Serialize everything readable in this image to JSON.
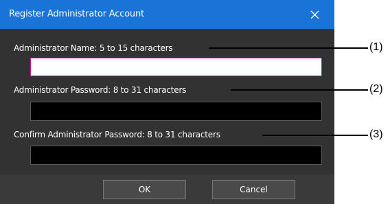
{
  "dialog": {
    "title": "Register Administrator Account",
    "close_icon": "close-icon",
    "fields": [
      {
        "label": "Administrator Name:  5 to 15 characters",
        "value": ""
      },
      {
        "label": "Administrator Password:  8 to 31 characters",
        "value": ""
      },
      {
        "label": "Confirm Administrator Password:  8 to 31 characters",
        "value": ""
      }
    ],
    "buttons": {
      "ok": "OK",
      "cancel": "Cancel"
    }
  },
  "callouts": [
    "(1)",
    "(2)",
    "(3)"
  ],
  "colors": {
    "titlebar": "#1a73d6",
    "dialog_bg": "#323232",
    "active_field_border": "#d0189a"
  }
}
